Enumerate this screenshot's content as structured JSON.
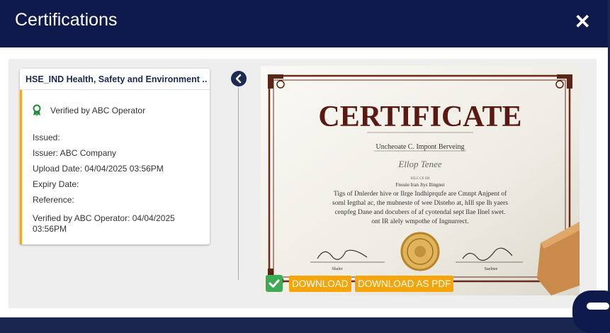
{
  "header": {
    "title": "Certifications",
    "close_label": "✕"
  },
  "card": {
    "title": "HSE_IND Health, Safety and Environment ...",
    "verified": "Verified by ABC Operator",
    "issued": "Issued:",
    "issuer": "Issuer: ABC Company",
    "upload_date": "Upload Date: 04/04/2025 03:56PM",
    "expiry": "Expiry Date:",
    "reference": "Reference:",
    "verified_line1": "Verified by ABC Operator: 04/04/2025",
    "verified_line2": "03:56PM"
  },
  "certificate": {
    "heading": "CERTIFICATE",
    "subtitle": "Uncheoate C. Impont Berveing",
    "signature": "Ellop Tenee",
    "small": "EILC CE SH",
    "lines": [
      "Fnouie Iran Jtys Ilingnut",
      "Tigs of Dnlerder hive or Ilrge Indhiprqufe are Cmnpt Anjpent of",
      "soml Iegthal ac, the mubneste of wee Disteho at, hIll spe Ih yaers",
      "cenpfeg Dane and docubers of af cyotendal sept Ilae Ilnel swet.",
      "ont IR alely wmpothe of Ingnurrect."
    ],
    "sig_left": "Sbaler",
    "sig_right": "Saelnee"
  },
  "actions": {
    "download": "DOWNLOAD",
    "download_pdf": "DOWNLOAD AS PDF"
  },
  "colors": {
    "header": "#0e1a4c",
    "accent": "#f5a50a",
    "verified_green": "#3daa55",
    "card_border": "#f5a623"
  }
}
